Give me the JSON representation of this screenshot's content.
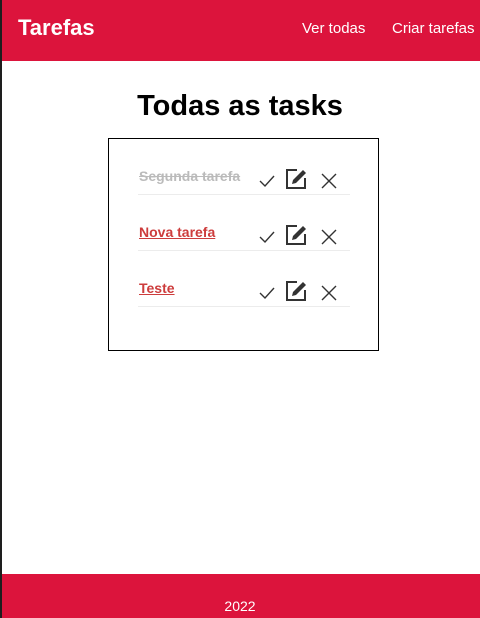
{
  "header": {
    "brand": "Tarefas",
    "nav": {
      "view_all": "Ver todas",
      "create": "Criar tarefas"
    }
  },
  "main": {
    "title": "Todas as tasks",
    "tasks": [
      {
        "title": "Segunda tarefa",
        "completed": true
      },
      {
        "title": "Nova tarefa",
        "completed": false
      },
      {
        "title": "Teste",
        "completed": false
      }
    ],
    "actions": {
      "complete_icon": "check-icon",
      "edit_icon": "edit-icon",
      "delete_icon": "close-icon"
    }
  },
  "footer": {
    "year": "2022"
  },
  "colors": {
    "brand": "#dc143c",
    "task_link": "#cd3c3c",
    "task_done": "#bbbbbb"
  }
}
